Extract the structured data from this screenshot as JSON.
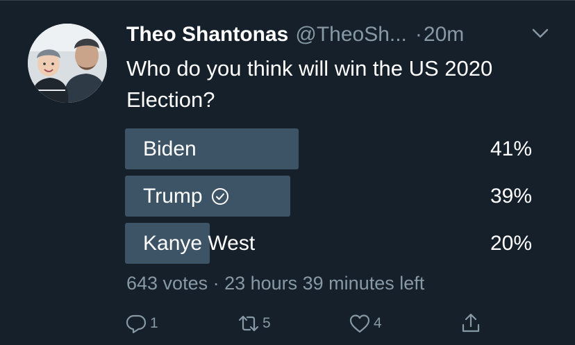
{
  "tweet": {
    "author_name": "Theo Shantonas",
    "author_handle": "@TheoSh...",
    "separator": "·",
    "time": "20m",
    "text": "Who do you think will win the US 2020 Election?"
  },
  "poll": {
    "options": [
      {
        "label": "Biden",
        "percent_text": "41%",
        "percent": 41,
        "winner": false
      },
      {
        "label": "Trump",
        "percent_text": "39%",
        "percent": 39,
        "winner": true
      },
      {
        "label": "Kanye West",
        "percent_text": "20%",
        "percent": 20,
        "winner": false
      }
    ],
    "meta": "643 votes · 23 hours 39 minutes left"
  },
  "actions": {
    "reply_count": "1",
    "retweet_count": "5",
    "like_count": "4"
  },
  "colors": {
    "background": "#15202b",
    "bar": "#3d5466",
    "secondary_text": "#8899a6",
    "primary_text": "#ffffff"
  },
  "icons": [
    "chevron-down-icon",
    "checkmark-circle-icon",
    "reply-icon",
    "retweet-icon",
    "like-icon",
    "share-icon"
  ]
}
